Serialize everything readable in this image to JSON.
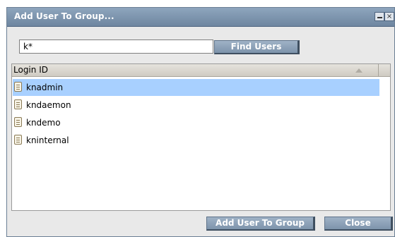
{
  "window": {
    "title": "Add User To Group...",
    "close_glyph": "×"
  },
  "search": {
    "value": "k*",
    "find_label": "Find Users"
  },
  "list": {
    "column_header": "Login ID",
    "users": [
      "knadmin",
      "kndaemon",
      "kndemo",
      "kninternal"
    ],
    "selected_index": 0
  },
  "footer": {
    "add_label": "Add User To Group",
    "close_label": "Close"
  },
  "colors": {
    "titlebar": "#7e95ae",
    "selection": "#a8d0ff",
    "button": "#8ea2b8"
  },
  "icons": {
    "user_row_icon": "document-icon",
    "minimize": "minimize-icon",
    "close": "close-icon",
    "sort": "sort-ascending-icon"
  }
}
